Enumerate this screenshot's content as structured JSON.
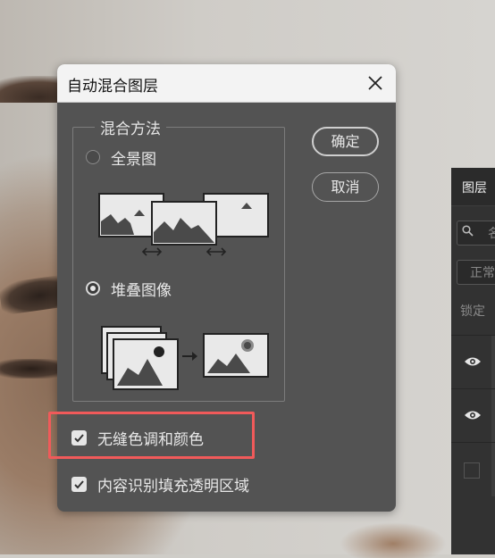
{
  "dialog": {
    "title": "自动混合图层",
    "blend_method_legend": "混合方法",
    "options": [
      {
        "label": "全景图",
        "selected": false
      },
      {
        "label": "堆叠图像",
        "selected": true
      }
    ],
    "ok_label": "确定",
    "cancel_label": "取消",
    "checkboxes": [
      {
        "label": "无缝色调和颜色",
        "checked": true
      },
      {
        "label": "内容识别填充透明区域",
        "checked": true
      }
    ]
  },
  "layers_panel": {
    "tab": "图层",
    "search_placeholder": "名",
    "blend_mode": "正常",
    "lock_label": "锁定"
  },
  "colors": {
    "dialog_bg": "#535353",
    "highlight": "#f15a5a",
    "titlebar": "#f3f3f3"
  }
}
